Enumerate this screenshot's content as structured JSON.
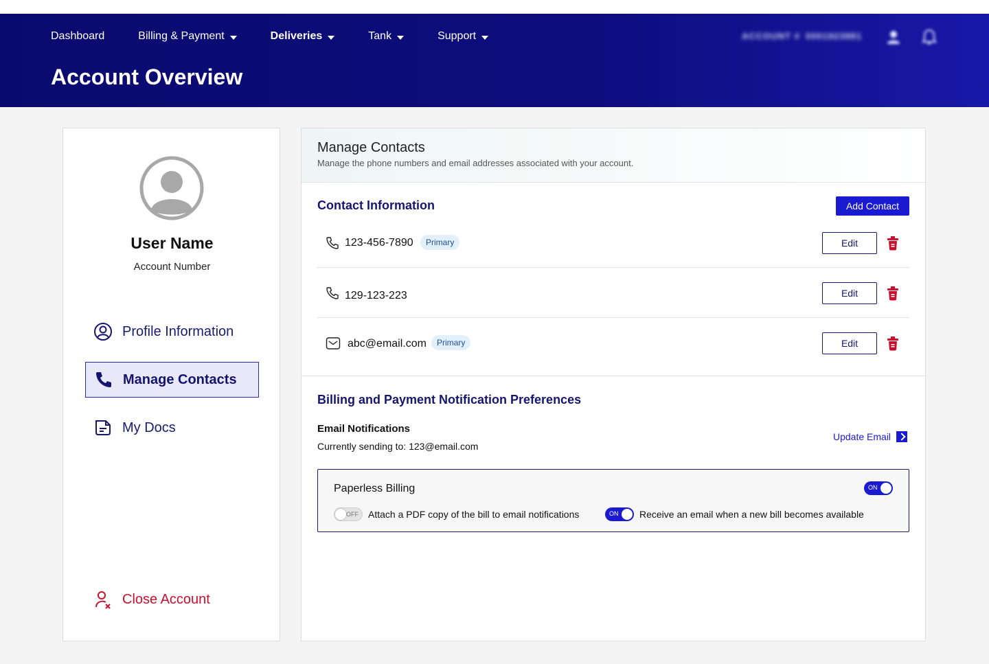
{
  "nav": {
    "items": [
      {
        "label": "Dashboard",
        "caret": false,
        "active": false
      },
      {
        "label": "Billing & Payment",
        "caret": true,
        "active": false
      },
      {
        "label": "Deliveries",
        "caret": true,
        "active": true
      },
      {
        "label": "Tank",
        "caret": true,
        "active": false
      },
      {
        "label": "Support",
        "caret": true,
        "active": false
      }
    ],
    "account_blurred": "ACCOUNT #",
    "account_number_blurred": "0001923881"
  },
  "page_title": "Account Overview",
  "profile": {
    "user_name": "User Name",
    "account_number_label": "Account Number"
  },
  "sidebar": {
    "items": [
      {
        "label": "Profile Information",
        "icon": "user-circle-icon"
      },
      {
        "label": "Manage Contacts",
        "icon": "phone-icon"
      },
      {
        "label": "My Docs",
        "icon": "document-icon"
      }
    ],
    "close_account": "Close Account"
  },
  "manage_contacts": {
    "title": "Manage Contacts",
    "subtitle": "Manage the phone numbers and email addresses associated with your account.",
    "contact_info_title": "Contact Information",
    "add_contact_label": "Add Contact",
    "contacts": [
      {
        "type": "phone",
        "value": "123-456-7890",
        "badge": "Primary",
        "edit_label": "Edit"
      },
      {
        "type": "phone",
        "value": "129-123-223",
        "badge": "",
        "edit_label": "Edit"
      },
      {
        "type": "email",
        "value": "abc@email.com",
        "badge": "Primary",
        "edit_label": "Edit"
      }
    ]
  },
  "billing_prefs": {
    "title": "Billing and Payment Notification Preferences",
    "email_notifications_label": "Email Notifications",
    "currently_sending": "Currently sending to: 123@email.com",
    "update_email_label": "Update Email",
    "paperless": {
      "title": "Paperless Billing",
      "main_toggle": "ON",
      "options": [
        {
          "toggle": "OFF",
          "label": "Attach a PDF copy of the bill to email notifications"
        },
        {
          "toggle": "ON",
          "label": "Receive an email when a new bill becomes available"
        }
      ]
    }
  },
  "colors": {
    "header_bg": "#0d0d7e",
    "accent_blue": "#1a1ad0",
    "danger_red": "#c8102e",
    "navy_text": "#16166e"
  }
}
